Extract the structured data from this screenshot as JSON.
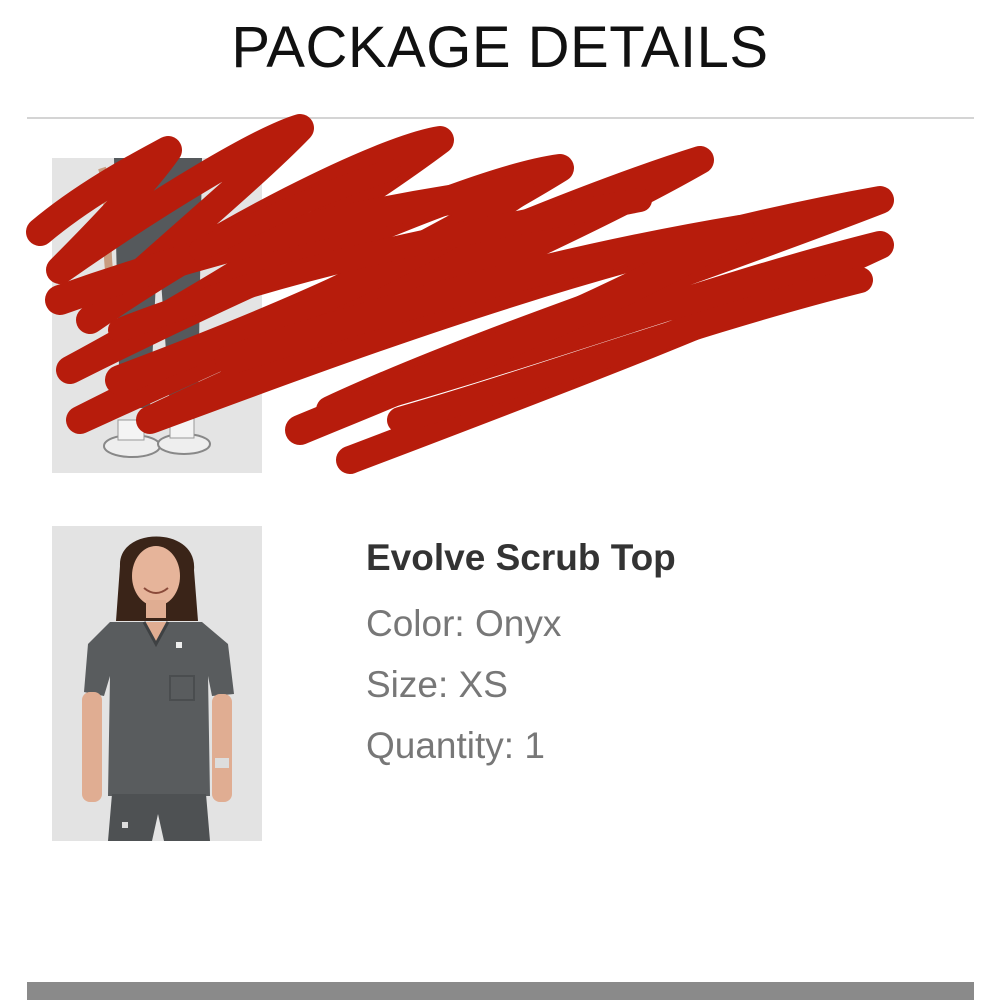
{
  "header": {
    "title": "PACKAGE DETAILS"
  },
  "items": [
    {
      "name": "",
      "attributes": [],
      "redacted": true
    },
    {
      "name": "Evolve Scrub Top",
      "attributes": [
        {
          "label": "Color",
          "value": "Onyx"
        },
        {
          "label": "Size",
          "value": "XS"
        },
        {
          "label": "Quantity",
          "value": "1"
        }
      ],
      "redacted": false
    }
  ],
  "colors": {
    "redaction": "#b71c0c",
    "scrub": "#595c5e",
    "divider": "#d4d4d4"
  }
}
